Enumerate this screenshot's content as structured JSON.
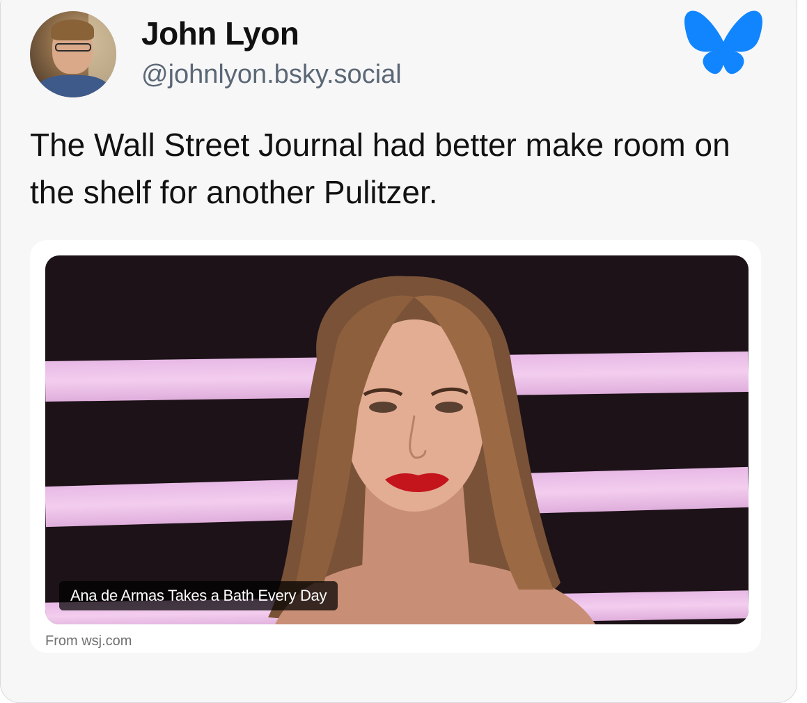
{
  "author": {
    "display_name": "John Lyon",
    "handle": "@johnlyon.bsky.social"
  },
  "post": {
    "text": "The Wall Street Journal had better make room on the shelf for another Pulitzer."
  },
  "link_card": {
    "caption": "Ana de Armas Takes a Bath Every Day",
    "source": "From wsj.com"
  },
  "icons": {
    "logo": "bluesky-butterfly-icon",
    "avatar": "profile-photo"
  },
  "colors": {
    "brand_blue": "#1185fe",
    "handle_gray": "#5b6775",
    "card_background": "#f7f7f8"
  }
}
